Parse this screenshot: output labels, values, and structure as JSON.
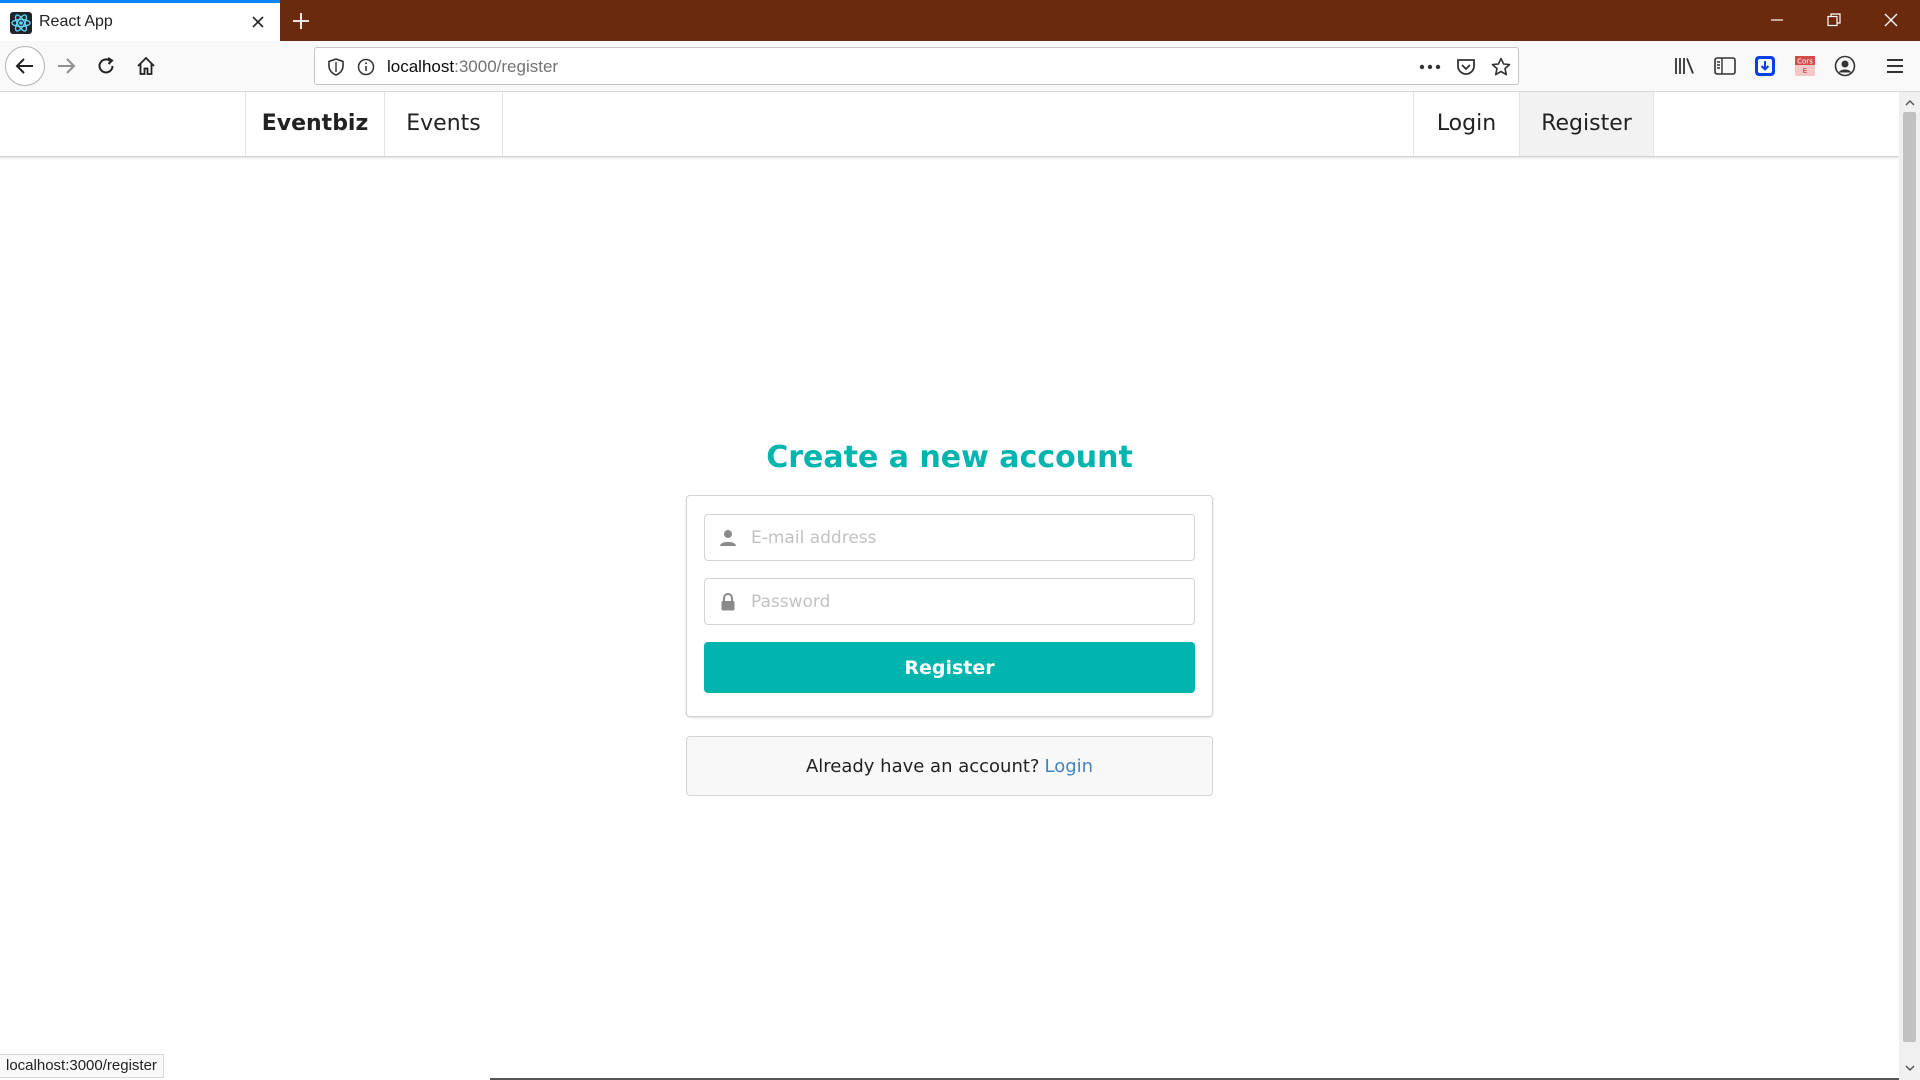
{
  "browser": {
    "tab_title": "React App",
    "url_host": "localhost",
    "url_path": ":3000/register",
    "status_text": "localhost:3000/register"
  },
  "icons": {
    "favicon": "react-icon",
    "back": "arrow-left-icon",
    "forward": "arrow-right-icon",
    "reload": "reload-icon",
    "home": "home-icon",
    "shield": "shield-icon",
    "info": "info-icon",
    "more": "ellipsis-icon",
    "pocket": "pocket-icon",
    "star": "star-icon",
    "library": "library-icon",
    "sidebar": "sidebar-icon",
    "download": "download-icon",
    "cors": "cors-extension-icon",
    "account": "account-icon",
    "menu": "hamburger-icon",
    "email_field": "user-icon",
    "password_field": "lock-icon"
  },
  "nav": {
    "brand": "Eventbiz",
    "events": "Events",
    "login": "Login",
    "register": "Register"
  },
  "form": {
    "heading": "Create a new account",
    "email_placeholder": "E-mail address",
    "password_placeholder": "Password",
    "submit_label": "Register"
  },
  "footer_message": {
    "text": "Already have an account?",
    "link": "Login"
  },
  "colors": {
    "accent": "#00b5ad",
    "link": "#4183c4",
    "titlebar": "#6b2a0e",
    "tab_indicator": "#0a84ff"
  }
}
